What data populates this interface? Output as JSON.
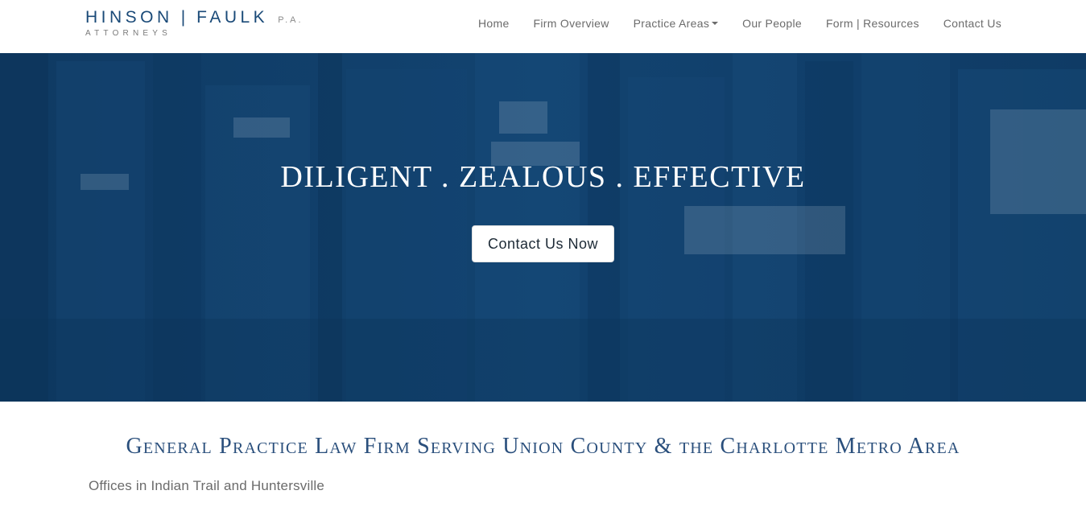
{
  "logo": {
    "name_left": "HINSON",
    "separator": "|",
    "name_right": "FAULK",
    "suffix": "P.A.",
    "subtitle": "ATTORNEYS",
    "color": "#1a4a78"
  },
  "nav": {
    "items": [
      {
        "label": "Home"
      },
      {
        "label": "Firm Overview"
      },
      {
        "label": "Practice Areas",
        "has_dropdown": true
      },
      {
        "label": "Our People"
      },
      {
        "label": "Form | Resources"
      },
      {
        "label": "Contact Us"
      }
    ]
  },
  "hero": {
    "title": "DILIGENT . ZEALOUS . EFFECTIVE",
    "cta_label": "Contact Us Now",
    "background_color": "#113f6a"
  },
  "intro": {
    "heading": "General Practice Law Firm Serving Union County & the Charlotte Metro Area",
    "subheading": "Offices in Indian Trail and Huntersville"
  }
}
